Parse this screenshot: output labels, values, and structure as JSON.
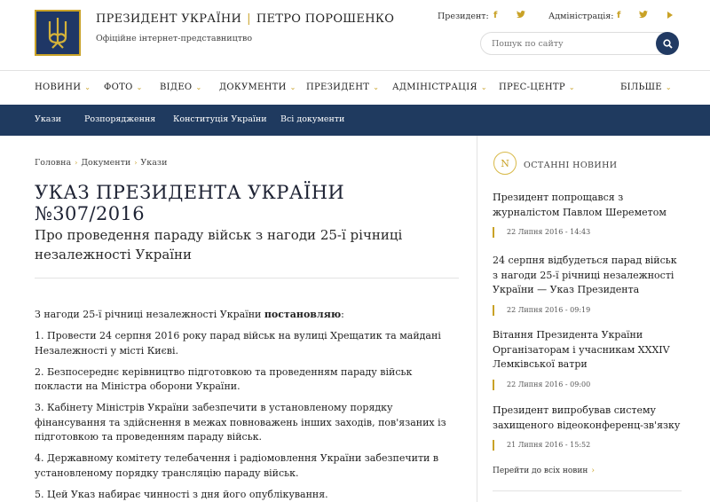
{
  "header": {
    "title_left": "ПРЕЗИДЕНТ УКРАЇНИ",
    "title_sep": "|",
    "title_right": "ПЕТРО ПОРОШЕНКО",
    "subtitle": "Офіційне інтернет-представництво",
    "president_label": "Президент:",
    "administration_label": "Адміністрація:",
    "search_placeholder": "Пошук по сайту"
  },
  "main_nav": [
    {
      "label": "НОВИНИ"
    },
    {
      "label": "ФОТО"
    },
    {
      "label": "ВІДЕО"
    },
    {
      "label": "ДОКУМЕНТИ"
    },
    {
      "label": "ПРЕЗИДЕНТ"
    },
    {
      "label": "АДМІНІСТРАЦІЯ"
    },
    {
      "label": "ПРЕС-ЦЕНТР"
    },
    {
      "label": "БІЛЬШЕ"
    }
  ],
  "sub_nav": [
    {
      "label": "Укази"
    },
    {
      "label": "Розпорядження"
    },
    {
      "label": "Конституція України"
    },
    {
      "label": "Всі документи"
    }
  ],
  "breadcrumb": [
    "Головна",
    "Документи",
    "Укази"
  ],
  "article": {
    "title": "УКАЗ ПРЕЗИДЕНТА УКРАЇНИ №307/2016",
    "subtitle": "Про проведення параду військ з нагоди 25-ї річниці незалежності України",
    "intro_text": "З нагоди 25-ї річниці незалежності України ",
    "intro_bold": "постановляю",
    "intro_end": ":",
    "paragraphs": [
      "1. Провести 24 серпня 2016 року парад військ на вулиці Хрещатик та майдані Незалежності у місті Києві.",
      "2. Безпосереднє керівництво підготовкою та проведенням параду військ покласти на Міністра оборони України.",
      "3. Кабінету Міністрів України забезпечити в установленому порядку фінансування та здійснення в межах повноважень інших заходів, пов'язаних із підготовкою та проведенням параду військ.",
      "4. Державному комітету телебачення і радіомовлення України забезпечити в установленому порядку трансляцію параду військ.",
      "5. Цей Указ набирає чинності з дня його опублікування."
    ]
  },
  "sidebar": {
    "heading": "ОСТАННІ НОВИНИ",
    "news": [
      {
        "title": "Президент попрощався з журналістом Павлом Шереметом",
        "date": "22 Липня 2016 - 14:43"
      },
      {
        "title": "24 серпня відбудеться парад військ з нагоди 25-ї річниці незалежності України — Указ Президента",
        "date": "22 Липня 2016 - 09:19"
      },
      {
        "title": "Вітання Президента України Організаторам і учасникам XXXIV Лемківської ватри",
        "date": "22 Липня 2016 - 09:00"
      },
      {
        "title": "Президент випробував систему захищеного відеоконференц-зв'язку",
        "date": "21 Липня 2016 - 15:52"
      }
    ],
    "all_news_label": "Перейти до всіх новин"
  },
  "colors": {
    "accent_gold": "#c9a227",
    "navy": "#1f3a5f"
  },
  "icons": {
    "logo": "trident-emblem-icon",
    "facebook": "facebook-icon",
    "twitter": "twitter-icon",
    "search": "search-icon",
    "news_heading": "news-icon"
  }
}
